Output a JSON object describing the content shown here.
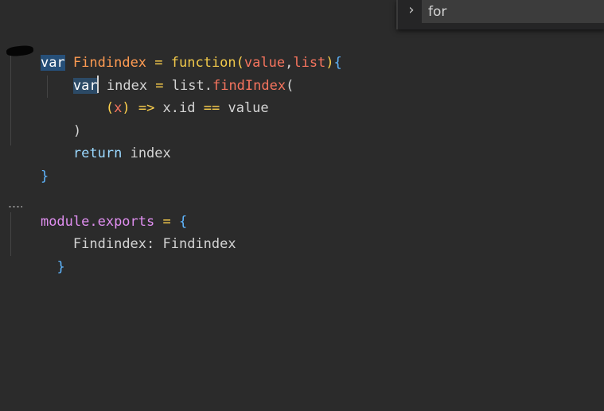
{
  "find_widget": {
    "toggle_glyph": "›",
    "query": "for"
  },
  "code": {
    "line1": {
      "kw_var": "var",
      "name": "Findindex",
      "eq": " = ",
      "func": "function",
      "open_paren": "(",
      "p1": "value",
      "comma": ",",
      "p2": "list",
      "close_paren": ")",
      "brace": "{"
    },
    "line2": {
      "indent": "    ",
      "kw_var": "var",
      "ident": "index",
      "eq": " = ",
      "obj": "list.",
      "method": "findIndex",
      "open_paren": "("
    },
    "line3": {
      "indent": "        ",
      "open_paren": "(",
      "arg": "x",
      "close_paren": ")",
      "arrow": " => ",
      "expr": "x.id",
      "op": " == ",
      "rhs": "value"
    },
    "line4": {
      "indent": "    ",
      "text": ")"
    },
    "line5": {
      "indent": "    ",
      "kw": "return",
      "ident": "index"
    },
    "line6": {
      "text": "}"
    },
    "line8": {
      "mod": "module.exports",
      "eq": " = ",
      "brace": "{"
    },
    "line9": {
      "indent": "    ",
      "key": "Findindex: ",
      "value": "Findindex"
    },
    "line10": {
      "indent": "  ",
      "text": "}"
    }
  }
}
